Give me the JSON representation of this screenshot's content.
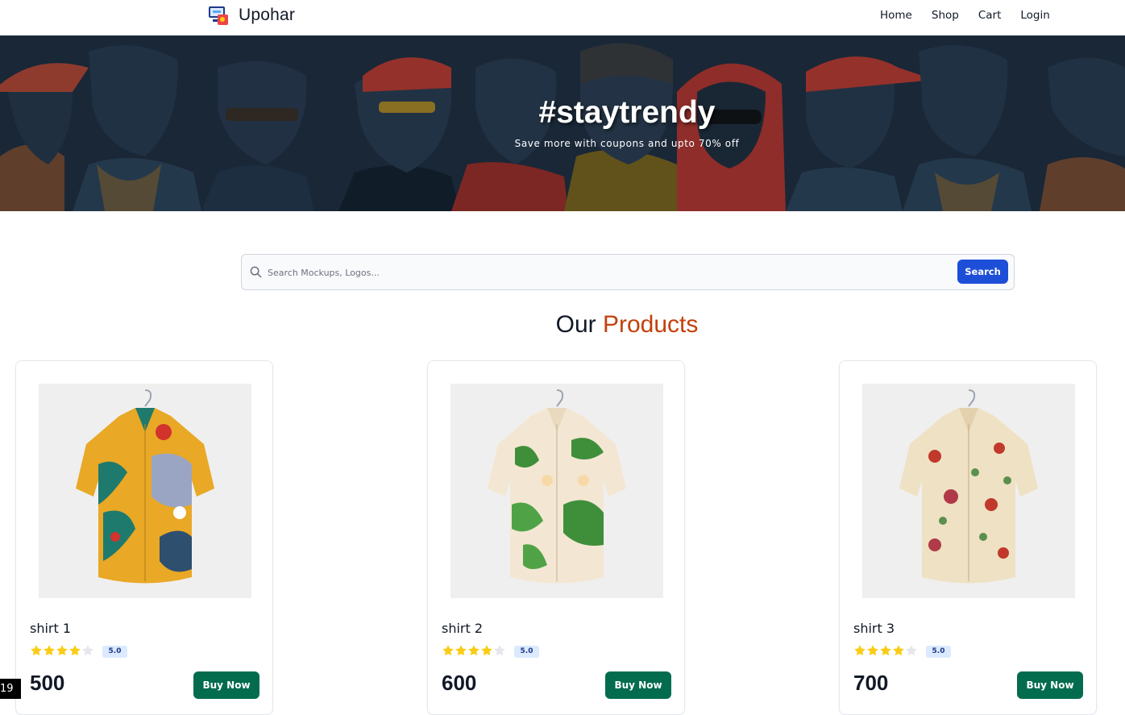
{
  "navbar": {
    "brand": "Upohar",
    "links": [
      "Home",
      "Shop",
      "Cart",
      "Login"
    ]
  },
  "hero": {
    "title": "#staytrendy",
    "subtitle": "Save more with coupons and upto 70% off"
  },
  "search": {
    "placeholder": "Search Mockups, Logos...",
    "value": "",
    "button_label": "Search"
  },
  "section": {
    "title_prefix": "Our",
    "title_accent": "Products"
  },
  "products": [
    {
      "name": "shirt 1",
      "rating": 4,
      "rating_label": "5.0",
      "price": "500",
      "buy_label": "Buy Now"
    },
    {
      "name": "shirt 2",
      "rating": 4,
      "rating_label": "5.0",
      "price": "600",
      "buy_label": "Buy Now"
    },
    {
      "name": "shirt 3",
      "rating": 4,
      "rating_label": "5.0",
      "price": "700",
      "buy_label": "Buy Now"
    }
  ],
  "page_indicator": "19",
  "colors": {
    "accent": "#c2410c",
    "search_button": "#1d4ed8",
    "buy_button": "#046c4e",
    "star_filled": "#facc15",
    "star_empty": "#e5e7eb"
  }
}
